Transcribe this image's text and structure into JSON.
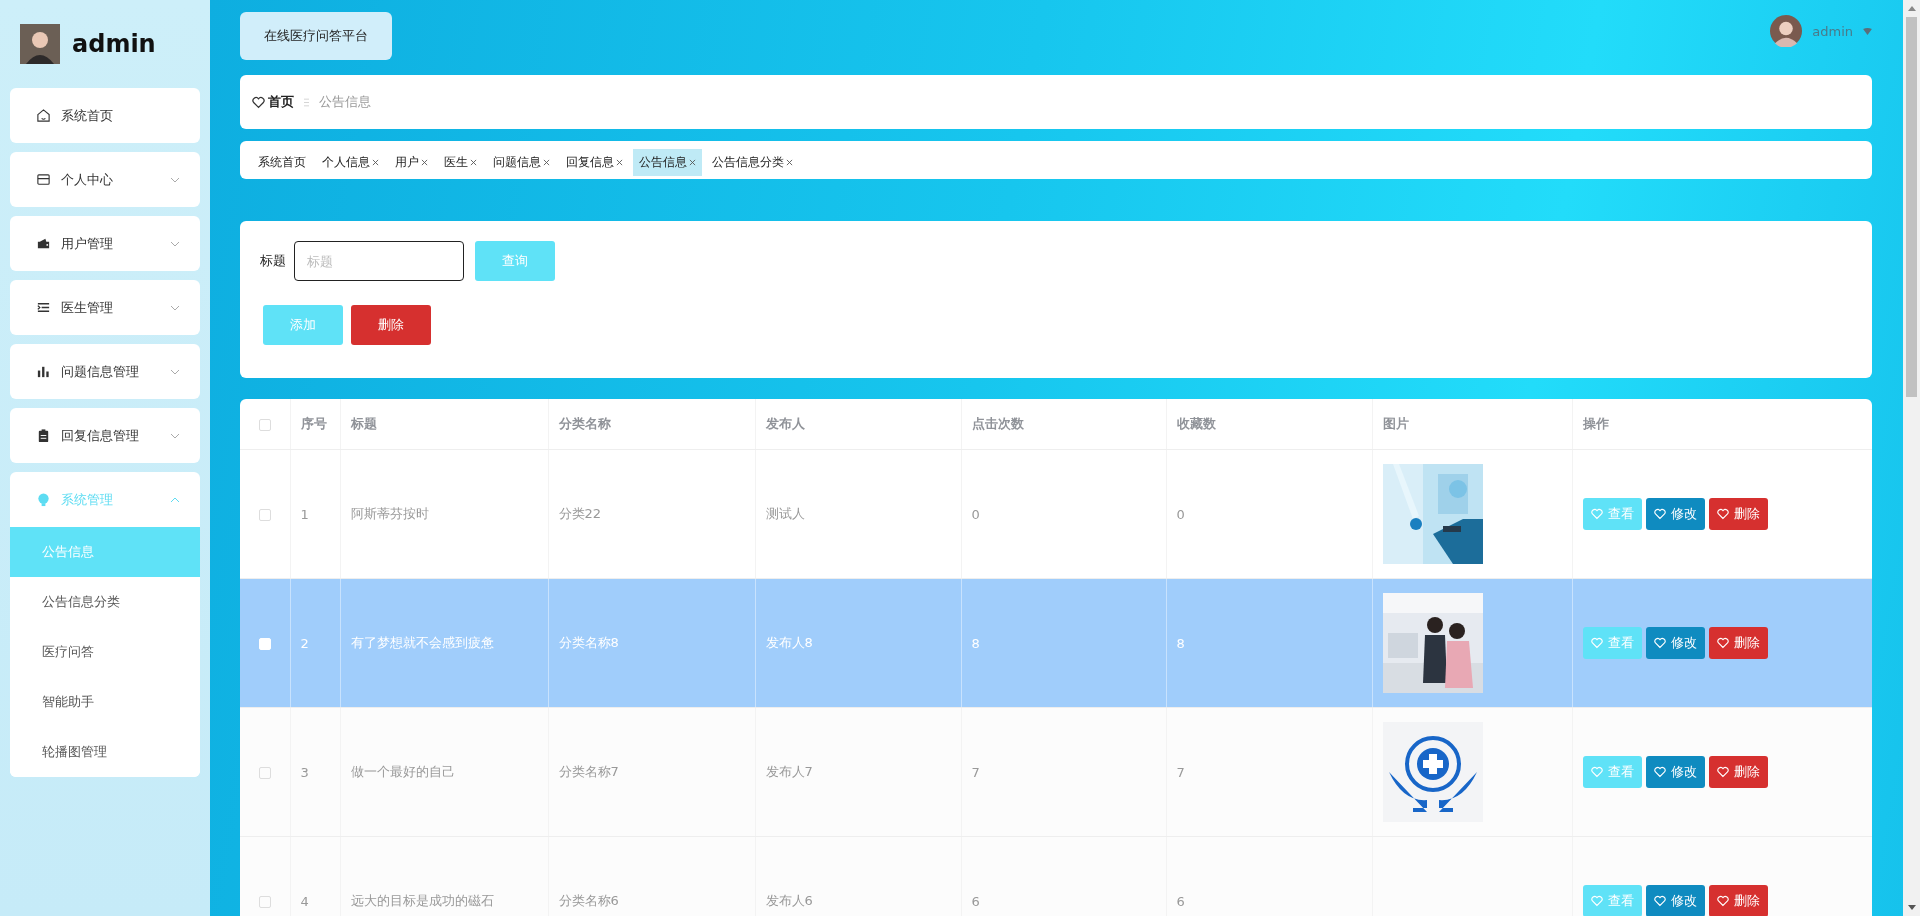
{
  "user": {
    "name": "admin"
  },
  "sidebar": {
    "items": [
      {
        "label": "系统首页",
        "kind": "link"
      },
      {
        "label": "个人中心",
        "kind": "group",
        "expanded": false
      },
      {
        "label": "用户管理",
        "kind": "group",
        "expanded": false
      },
      {
        "label": "医生管理",
        "kind": "group",
        "expanded": false
      },
      {
        "label": "问题信息管理",
        "kind": "group",
        "expanded": false
      },
      {
        "label": "回复信息管理",
        "kind": "group",
        "expanded": false
      },
      {
        "label": "系统管理",
        "kind": "group",
        "expanded": true,
        "children": [
          {
            "label": "公告信息",
            "selected": true
          },
          {
            "label": "公告信息分类",
            "selected": false
          },
          {
            "label": "医疗问答",
            "selected": false
          },
          {
            "label": "智能助手",
            "selected": false
          },
          {
            "label": "轮播图管理",
            "selected": false
          }
        ]
      }
    ]
  },
  "header": {
    "title": "在线医疗问答平台",
    "user": "admin"
  },
  "breadcrumb": [
    "首页",
    "公告信息"
  ],
  "tabs": [
    {
      "label": "系统首页",
      "closable": false,
      "selected": false
    },
    {
      "label": "个人信息",
      "closable": true,
      "selected": false
    },
    {
      "label": "用户",
      "closable": true,
      "selected": false
    },
    {
      "label": "医生",
      "closable": true,
      "selected": false
    },
    {
      "label": "问题信息",
      "closable": true,
      "selected": false
    },
    {
      "label": "回复信息",
      "closable": true,
      "selected": false
    },
    {
      "label": "公告信息",
      "closable": true,
      "selected": true
    },
    {
      "label": "公告信息分类",
      "closable": true,
      "selected": false
    }
  ],
  "search": {
    "label": "标题",
    "placeholder": "标题",
    "button": "查询"
  },
  "toolbar": [
    {
      "label": "添加",
      "kind": "add"
    },
    {
      "label": "删除",
      "kind": "delete"
    }
  ],
  "table": {
    "header_checked": false,
    "columns": [
      "序号",
      "标题",
      "分类名称",
      "发布人",
      "点击次数",
      "收藏数",
      "图片",
      "操作"
    ],
    "rows": [
      {
        "index": "1",
        "title": "阿斯蒂芬按时",
        "category": "分类22",
        "publisher": "测试人",
        "clicks": "0",
        "favorites": "0",
        "picture": true,
        "selected": false,
        "checked": false,
        "actions": [
          {
            "label": "查看",
            "kind": "view"
          },
          {
            "label": "修改",
            "kind": "edit"
          },
          {
            "label": "删除",
            "kind": "delete"
          }
        ]
      },
      {
        "index": "2",
        "title": "有了梦想就不会感到疲惫",
        "category": "分类名称8",
        "publisher": "发布人8",
        "clicks": "8",
        "favorites": "8",
        "picture": true,
        "selected": true,
        "checked": false,
        "actions": [
          {
            "label": "查看",
            "kind": "view"
          },
          {
            "label": "修改",
            "kind": "edit"
          },
          {
            "label": "删除",
            "kind": "delete"
          }
        ]
      },
      {
        "index": "3",
        "title": "做一个最好的自己",
        "category": "分类名称7",
        "publisher": "发布人7",
        "clicks": "7",
        "favorites": "7",
        "picture": true,
        "selected": false,
        "checked": false,
        "actions": [
          {
            "label": "查看",
            "kind": "view"
          },
          {
            "label": "修改",
            "kind": "edit"
          },
          {
            "label": "删除",
            "kind": "delete"
          }
        ]
      },
      {
        "index": "4",
        "title": "远大的目标是成功的磁石",
        "category": "分类名称6",
        "publisher": "发布人6",
        "clicks": "6",
        "favorites": "6",
        "picture": false,
        "selected": false,
        "checked": false,
        "actions": [
          {
            "label": "查看",
            "kind": "view"
          },
          {
            "label": "修改",
            "kind": "edit"
          },
          {
            "label": "删除",
            "kind": "delete"
          }
        ]
      }
    ]
  }
}
